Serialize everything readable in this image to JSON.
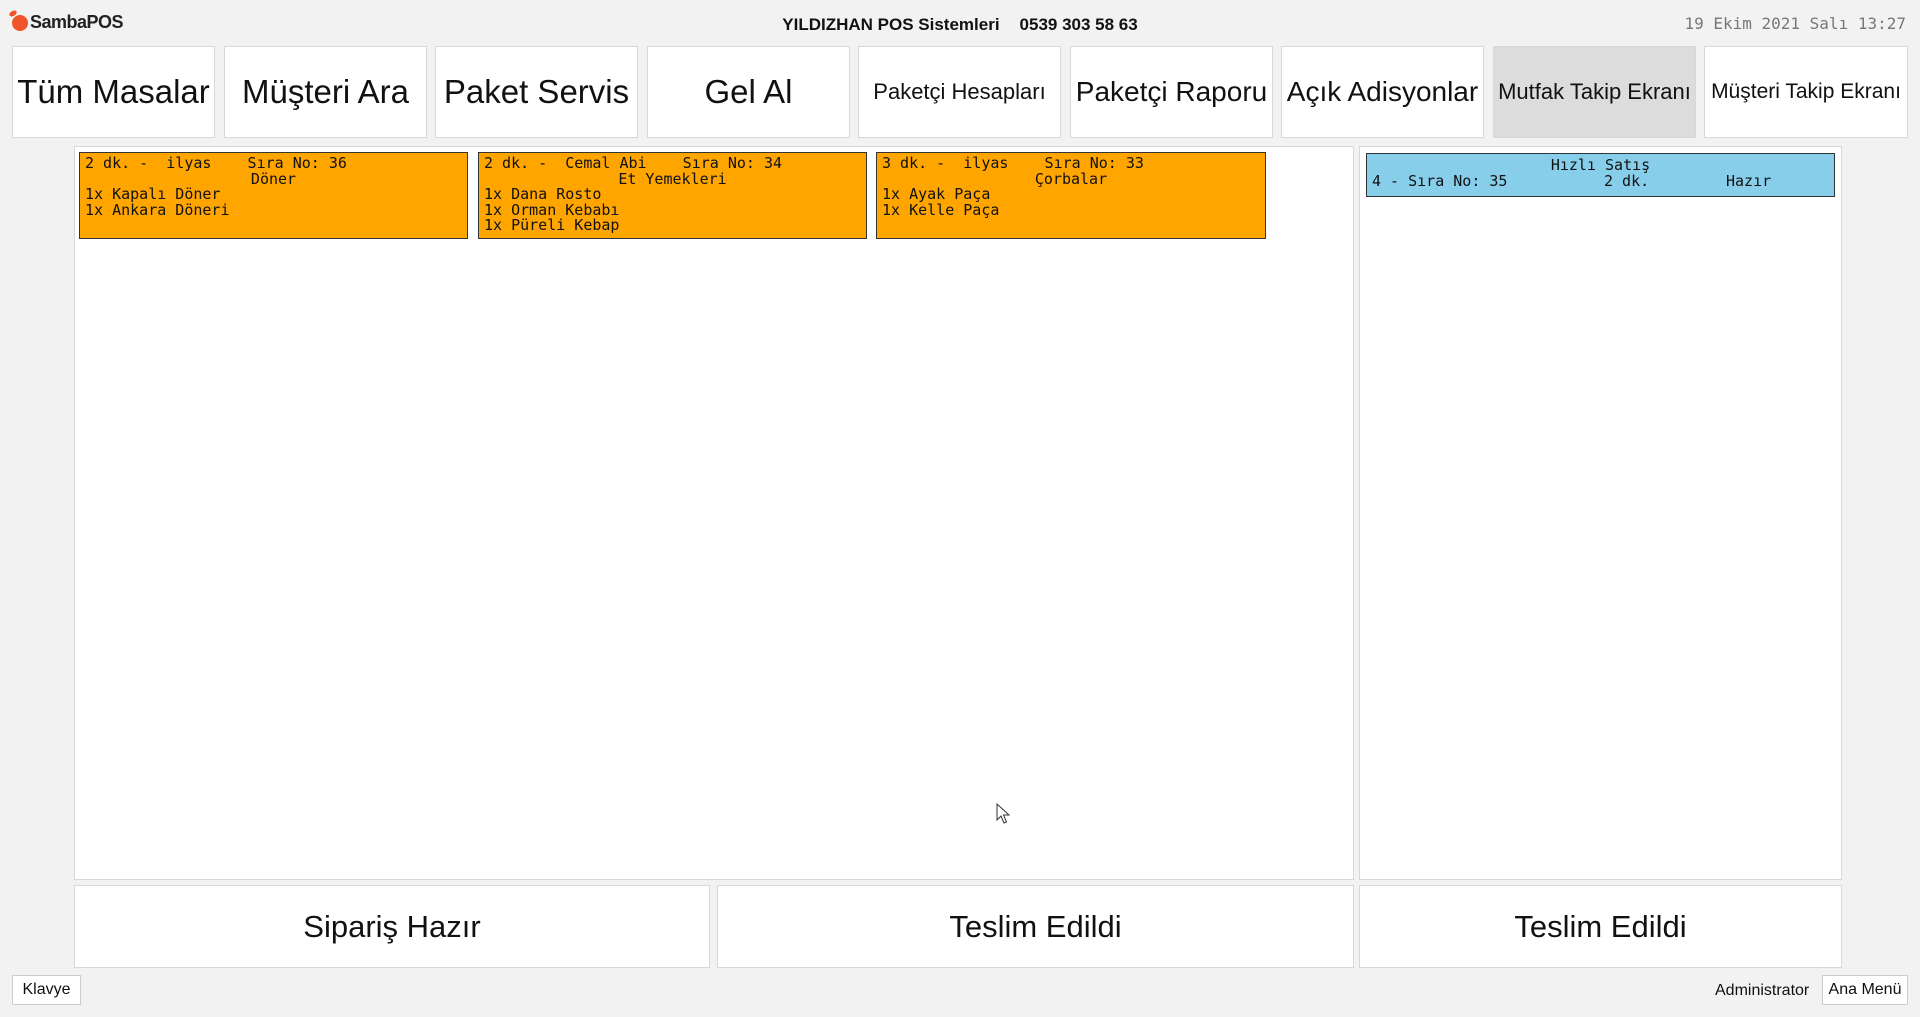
{
  "app": {
    "logo_text": "SambaPOS"
  },
  "header": {
    "company": "YILDIZHAN POS Sistemleri",
    "phone": "0539 303 58 63",
    "datetime": "19 Ekim 2021 Salı 13:27"
  },
  "nav": [
    {
      "label": "Tüm Masalar"
    },
    {
      "label": "Müşteri Ara"
    },
    {
      "label": "Paket Servis"
    },
    {
      "label": "Gel Al"
    },
    {
      "label": "Paketçi Hesapları"
    },
    {
      "label": "Paketçi Raporu"
    },
    {
      "label": "Açık Adisyonlar"
    },
    {
      "label": "Mutfak Takip Ekranı",
      "active": true
    },
    {
      "label": "Müşteri Takip Ekranı"
    }
  ],
  "tickets": [
    {
      "header": "2 dk. -  ilyas    Sıra No: 36",
      "category": "Döner",
      "items": [
        "1x Kapalı Döner",
        "1x Ankara Döneri"
      ]
    },
    {
      "header": "2 dk. -  Cemal Abi    Sıra No: 34",
      "category": "Et Yemekleri",
      "items": [
        "1x Dana Rosto",
        "1x Orman Kebabı",
        "1x Püreli Kebap"
      ]
    },
    {
      "header": "3 dk. -  ilyas    Sıra No: 33",
      "category": "Çorbalar",
      "items": [
        "1x Ayak Paça",
        "1x Kelle Paça"
      ]
    }
  ],
  "ready": {
    "title": "Hızlı Satış",
    "order": "4 - Sıra No: 35",
    "time": "2 dk.",
    "status": "Hazır"
  },
  "actions": {
    "order_ready": "Sipariş Hazır",
    "delivered_1": "Teslim Edildi",
    "delivered_2": "Teslim Edildi"
  },
  "footer": {
    "keyboard": "Klavye",
    "user": "Administrator",
    "main_menu": "Ana Menü"
  },
  "colors": {
    "ticket_bg": "#ffa500",
    "ready_bg": "#87ceeb",
    "active_nav": "#dcdcdc"
  }
}
